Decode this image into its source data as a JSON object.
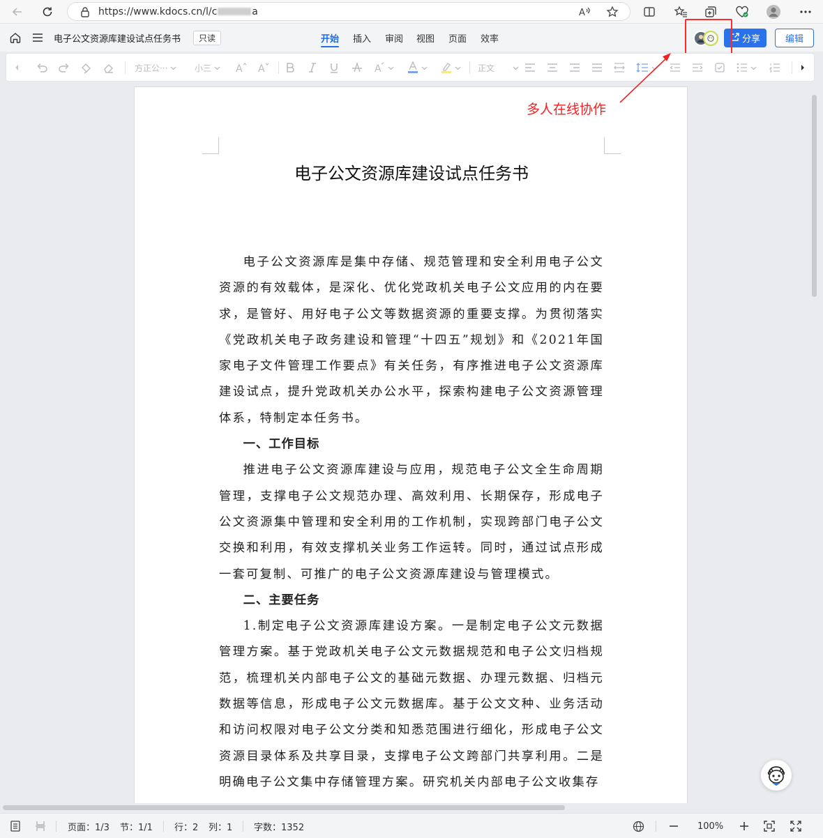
{
  "browser": {
    "url_prefix": "https://www.kdocs.cn/l/c",
    "url_suffix": "a"
  },
  "header": {
    "doc_title": "电子公文资源库建设试点任务书",
    "readonly": "只读",
    "tabs": [
      "开始",
      "插入",
      "审阅",
      "视图",
      "页面",
      "效率"
    ],
    "share": "分享",
    "edit": "编辑"
  },
  "toolbar": {
    "font_name": "方正公···",
    "font_size": "小三",
    "style": "正文"
  },
  "annotation": {
    "text": "多人在线协作"
  },
  "document": {
    "heading": "电子公文资源库建设试点任务书",
    "para1": "电子公文资源库是集中存储、规范管理和安全利用电子公文资源的有效载体，是深化、优化党政机关电子公文应用的内在要求，是管好、用好电子公文等数据资源的重要支撑。为贯彻落实《党政机关电子政务建设和管理“十四五”规划》和《2021年国家电子文件管理工作要点》有关任务，有序推进电子公文资源库建设试点，提升党政机关办公水平，探索构建电子公文资源管理体系，特制定本任务书。",
    "h1": "一、工作目标",
    "para2": "推进电子公文资源库建设与应用，规范电子公文全生命周期管理，支撑电子公文规范办理、高效利用、长期保存，形成电子公文资源集中管理和安全利用的工作机制，实现跨部门电子公文交换和利用，有效支撑机关业务工作运转。同时，通过试点形成一套可复制、可推广的电子公文资源库建设与管理模式。",
    "h2": "二、主要任务",
    "para3": "1.制定电子公文资源库建设方案。一是制定电子公文元数据管理方案。基于党政机关电子公文元数据规范和电子公文归档规范，梳理机关内部电子公文的基础元数据、办理元数据、归档元数据等信息，形成电子公文元数据库。基于公文文种、业务活动和访问权限对电子公文分类和知悉范围进行细化，形成电子公文资源目录体系及共享目录，支撑电子公文跨部门共享利用。二是明确电子公文集中存储管理方案。研究机关内部电子公文收集存"
  },
  "status": {
    "page": "页面：1/3",
    "section": "节：1/1",
    "row": "行：2",
    "col": "列：1",
    "words": "字数：1352",
    "zoom": "100%"
  }
}
